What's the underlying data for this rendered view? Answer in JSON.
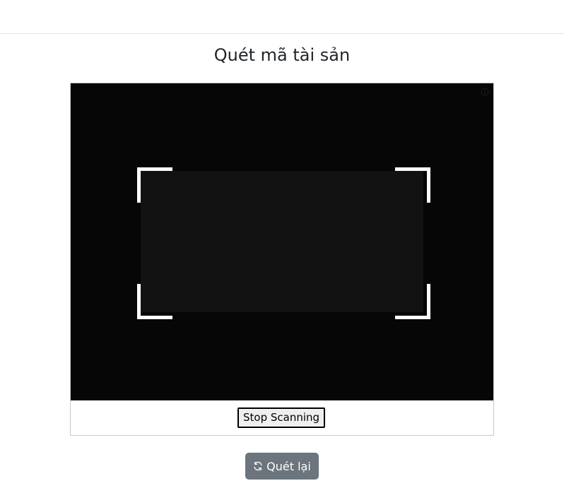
{
  "page": {
    "title": "Quét mã tài sản"
  },
  "scanner": {
    "stop_label": "Stop Scanning",
    "icons": {
      "info": "info-icon"
    }
  },
  "actions": {
    "rescan_label": "Quét lại",
    "rescan_icon": "refresh-icon"
  },
  "colors": {
    "video_bg": "#060606",
    "scan_region": "#121212",
    "rescan_button": "#6c757d",
    "corner": "#ffffff"
  }
}
